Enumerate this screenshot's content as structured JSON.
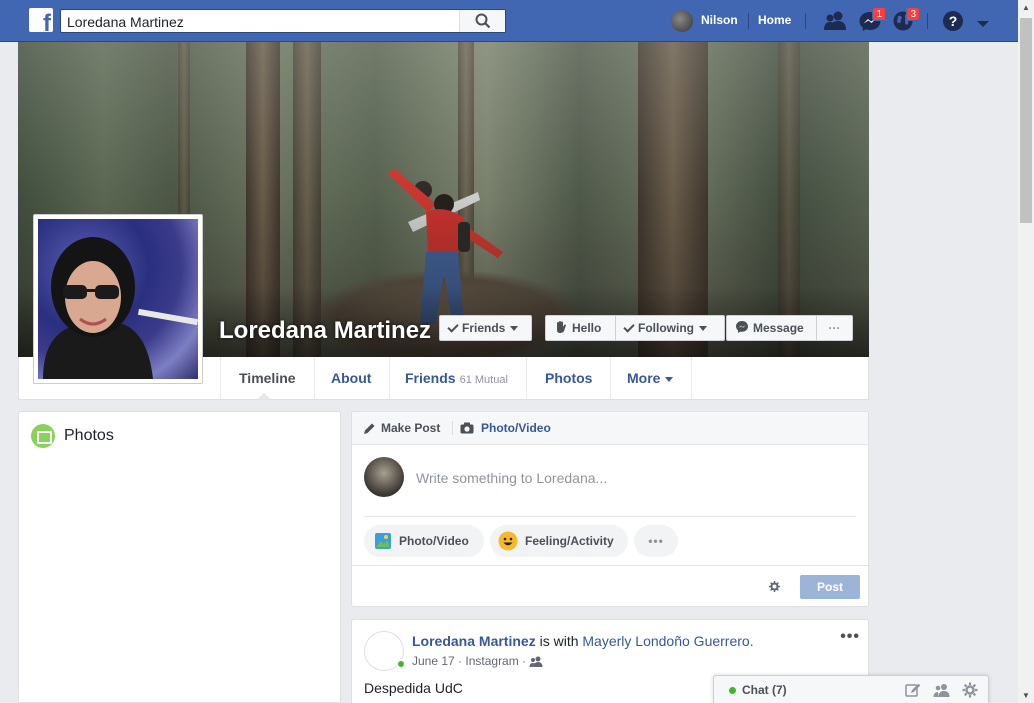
{
  "topbar": {
    "logo_glyph": "f",
    "search_value": "Loredana Martinez",
    "user_name": "Nilson",
    "home_label": "Home",
    "messages_badge": "1",
    "notifications_badge": "3",
    "brand_color": "#4267b2"
  },
  "profile": {
    "name": "Loredana Martinez",
    "buttons": {
      "friends": "Friends",
      "hello": "Hello",
      "following": "Following",
      "message": "Message",
      "more": "···"
    }
  },
  "tabs": {
    "timeline": "Timeline",
    "about": "About",
    "friends": "Friends",
    "friends_mutual": "61 Mutual",
    "photos": "Photos",
    "more": "More"
  },
  "photos_card": {
    "title": "Photos"
  },
  "composer": {
    "make_post": "Make Post",
    "photo_video_tab": "Photo/Video",
    "placeholder": "Write something to Loredana...",
    "photo_video": "Photo/Video",
    "feeling": "Feeling/Activity",
    "more": "•••",
    "post_button": "Post"
  },
  "post": {
    "author": "Loredana Martinez",
    "with_text": " is with ",
    "tagged": "Mayerly Londoño Guerrero.",
    "date": "June 17",
    "separator": " · ",
    "source": "Instagram",
    "separator2": " · ",
    "text": "Despedida UdC",
    "more": "•••"
  },
  "chat": {
    "label": "Chat (7)"
  }
}
